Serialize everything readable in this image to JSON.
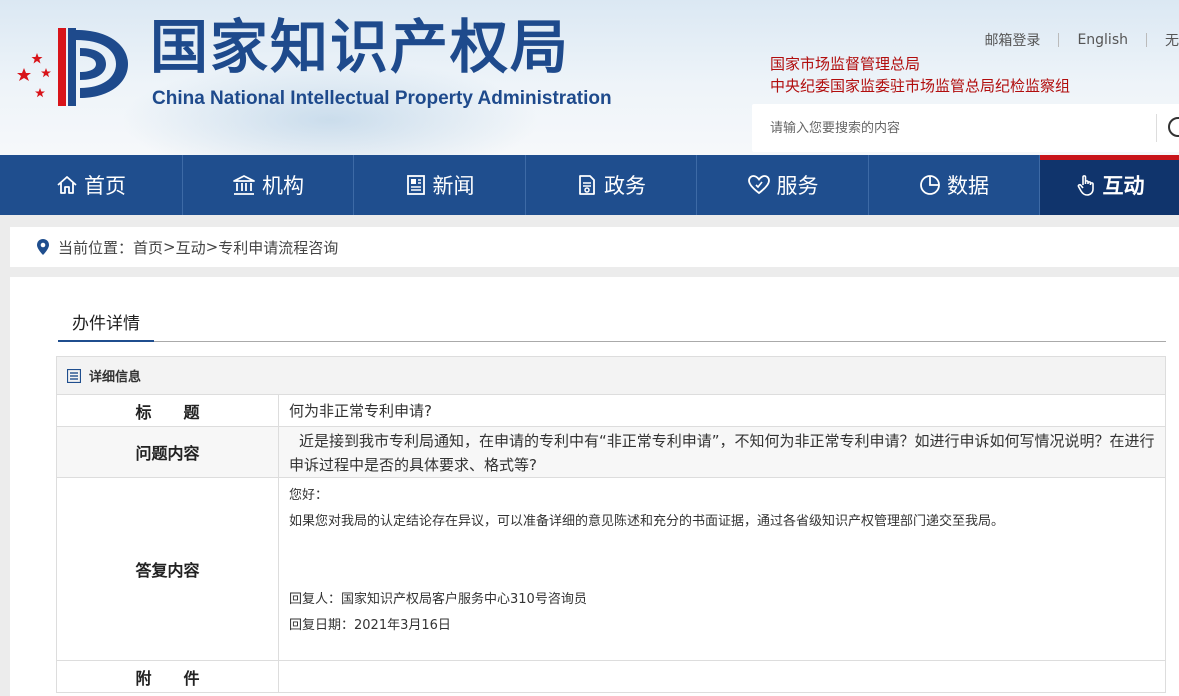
{
  "header": {
    "title": "国家知识产权局",
    "subtitle": "China National Intellectual Property Administration",
    "top_links": [
      "邮箱登录",
      "English",
      "无"
    ],
    "affiliations": [
      "国家市场监督管理总局",
      "中央纪委国家监委驻市场监管总局纪检监察组"
    ],
    "search_placeholder": "请输入您要搜索的内容"
  },
  "nav": {
    "items": [
      {
        "label": "首页",
        "icon": "home-icon"
      },
      {
        "label": "机构",
        "icon": "institution-icon"
      },
      {
        "label": "新闻",
        "icon": "news-icon"
      },
      {
        "label": "政务",
        "icon": "document-icon"
      },
      {
        "label": "服务",
        "icon": "heart-hand-icon"
      },
      {
        "label": "数据",
        "icon": "pie-chart-icon"
      },
      {
        "label": "互动",
        "icon": "hand-pointer-icon"
      }
    ],
    "active": "互动"
  },
  "breadcrumb": {
    "prefix": "当前位置：",
    "items": [
      "首页",
      "互动",
      "专利申请流程咨询"
    ],
    "separator": ">"
  },
  "panel": {
    "tab": "办件详情",
    "section_header": "详细信息",
    "rows": {
      "title_label": "标　　题",
      "title_value": "何为非正常专利申请?",
      "question_label": "问题内容",
      "question_value": "近是接到我市专利局通知，在申请的专利中有“非正常专利申请”，不知何为非正常专利申请？如进行申诉如何写情况说明？在进行申诉过程中是否的具体要求、格式等?",
      "answer_label": "答复内容",
      "answer_greeting": "您好：",
      "answer_body": "如果您对我局的认定结论存在异议，可以准备详细的意见陈述和充分的书面证据，通过各省级知识产权管理部门递交至我局。",
      "answer_responder": "回复人：国家知识产权局客户服务中心310号咨询员",
      "answer_date": "回复日期：2021年3月16日",
      "attachment_label": "附　　件",
      "attachment_value": ""
    }
  },
  "colors": {
    "nav_bg": "#1f4e8e",
    "nav_active_bg": "#10346c",
    "nav_active_accent": "#c8141a",
    "title_blue": "#1e4a8c",
    "affiliation_red": "#b10d0d"
  }
}
